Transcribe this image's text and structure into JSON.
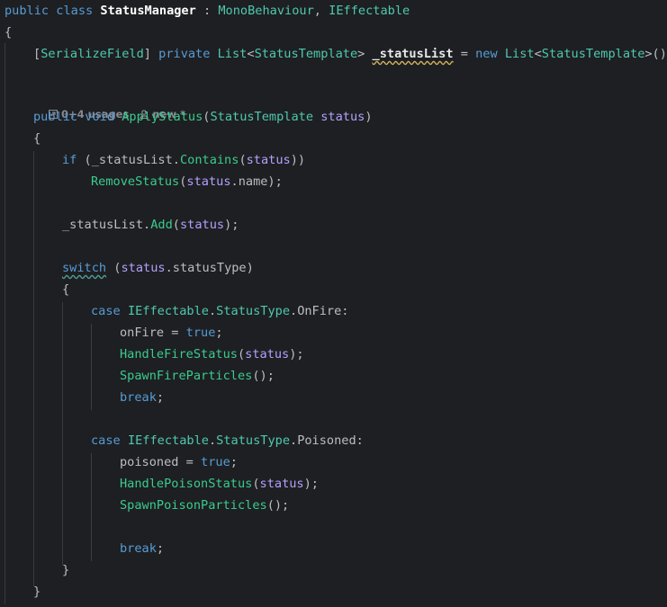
{
  "code": {
    "l1": {
      "kw1": "public",
      "kw2": "class",
      "cls": "StatusManager",
      "colon": " : ",
      "base1": "MonoBehaviour",
      "comma": ", ",
      "base2": "IEffectable"
    },
    "l2": {
      "brace": "{"
    },
    "l3": {
      "attr_open": "[",
      "attr": "SerializeField",
      "attr_close": "]",
      "kw1": "private",
      "type1": "List",
      "lt": "<",
      "type2": "StatusTemplate",
      "gt": ">",
      "field": "_statusList",
      "eq": " = ",
      "kw_new": "new",
      "type3": "List",
      "lt2": "<",
      "type4": "StatusTemplate",
      "rest": ">();"
    },
    "hint": {
      "usages": "0+4 usages",
      "author": "new *"
    },
    "l5": {
      "kw1": "public",
      "kw2": "void",
      "method": "ApplyStatus",
      "open": "(",
      "type": "StatusTemplate",
      "param": "status",
      "close": ")"
    },
    "l6": {
      "brace": "{"
    },
    "l7": {
      "kw": "if",
      "p1": " (_statusList.",
      "method": "Contains",
      "open": "(",
      "param": "status",
      "close": "))"
    },
    "l8": {
      "method": "RemoveStatus",
      "open": "(",
      "param": "status",
      "rest": ".name);"
    },
    "l10": {
      "p1": "_statusList.",
      "method": "Add",
      "open": "(",
      "param": "status",
      "close": ");"
    },
    "l12": {
      "kw": "switch",
      "open": " (",
      "param": "status",
      "rest": ".statusType)"
    },
    "l13": {
      "brace": "{"
    },
    "l14": {
      "kw": "case",
      "type1": "IEffectable",
      "dot1": ".",
      "type2": "StatusType",
      "dot2": ".",
      "member": "OnFire",
      "colon": ":"
    },
    "l15": {
      "p1": "onFire = ",
      "kw": "true",
      "semi": ";"
    },
    "l16": {
      "method": "HandleFireStatus",
      "open": "(",
      "param": "status",
      "close": ");"
    },
    "l17": {
      "method": "SpawnFireParticles",
      "rest": "();"
    },
    "l18": {
      "kw": "break",
      "semi": ";"
    },
    "l20": {
      "kw": "case",
      "type1": "IEffectable",
      "dot1": ".",
      "type2": "StatusType",
      "dot2": ".",
      "member": "Poisoned",
      "colon": ":"
    },
    "l21": {
      "p1": "poisoned = ",
      "kw": "true",
      "semi": ";"
    },
    "l22": {
      "method": "HandlePoisonStatus",
      "open": "(",
      "param": "status",
      "close": ");"
    },
    "l23": {
      "method": "SpawnPoisonParticles",
      "rest": "();"
    },
    "l25": {
      "kw": "break",
      "semi": ";"
    },
    "l26": {
      "brace": "}"
    },
    "l27": {
      "brace": "}"
    }
  },
  "colors": {
    "background": "#1e1f22",
    "keyword": "#569cd6",
    "type": "#4ec9b0",
    "method": "#39cc8f",
    "parameter": "#b4a0ff",
    "text": "#bcbec4"
  },
  "icons": {
    "usages": "usages-arrow-icon",
    "author": "user-icon"
  }
}
